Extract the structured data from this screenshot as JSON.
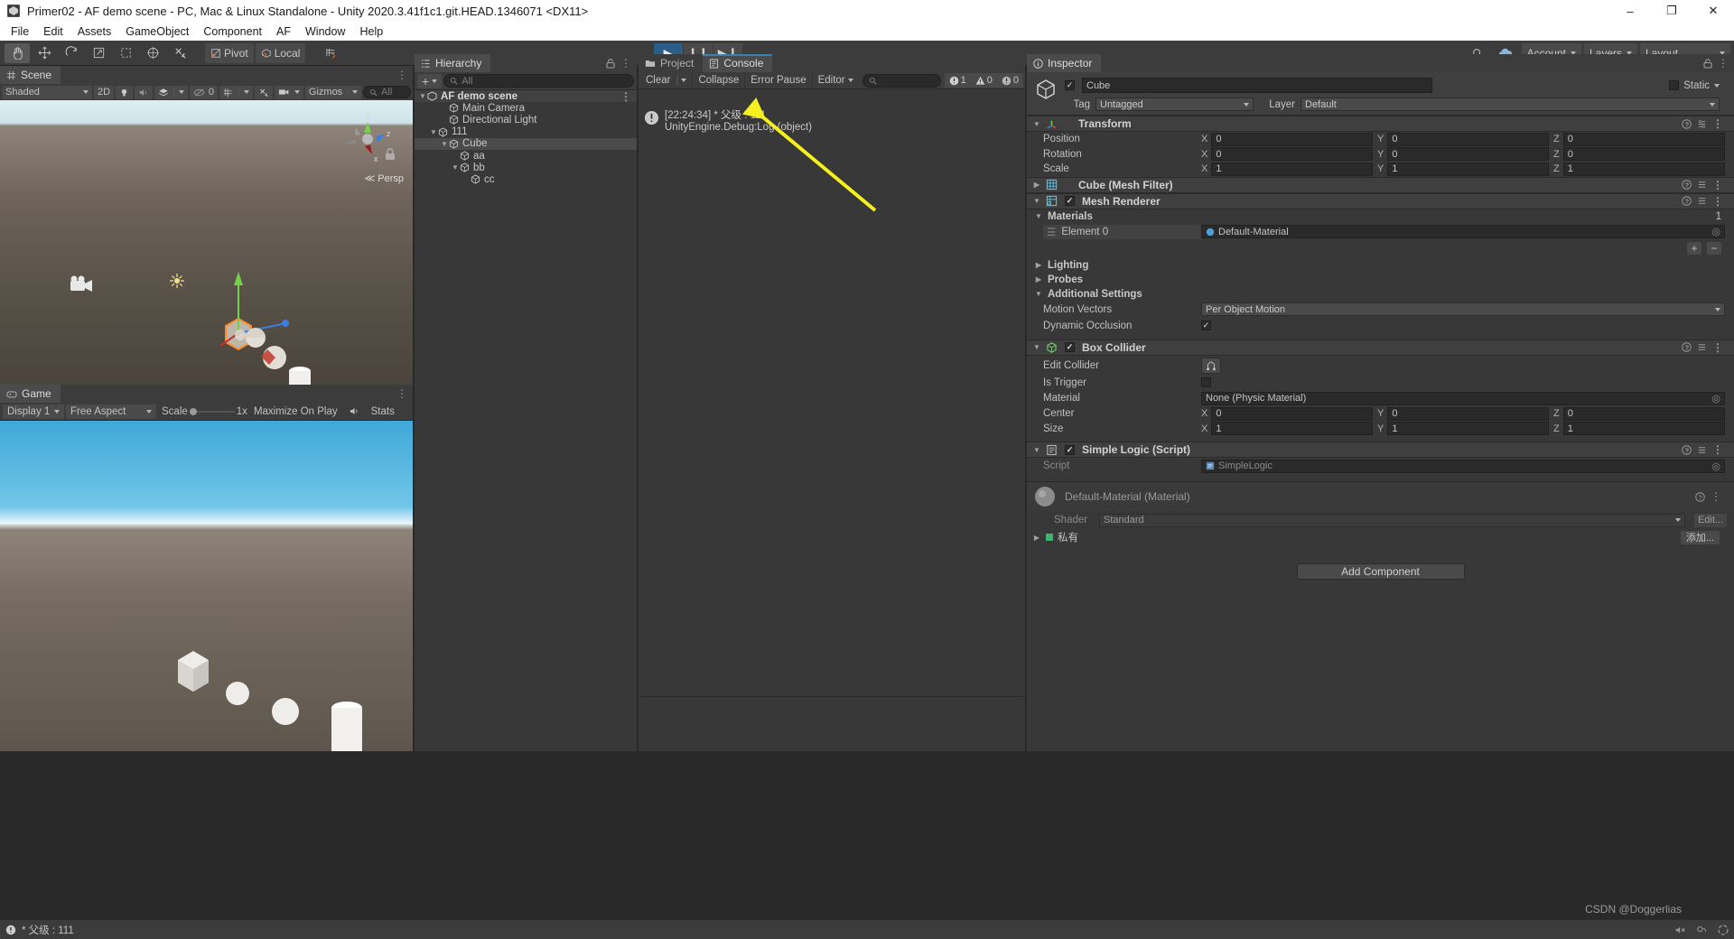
{
  "window": {
    "title": "Primer02 - AF demo scene - PC, Mac & Linux Standalone - Unity 2020.3.41f1c1.git.HEAD.1346071 <DX11>",
    "minimize": "–",
    "maximize": "❐",
    "close": "✕"
  },
  "menubar": {
    "items": [
      "File",
      "Edit",
      "Assets",
      "GameObject",
      "Component",
      "AF",
      "Window",
      "Help"
    ]
  },
  "toolbar": {
    "tools": [
      {
        "name": "hand-tool",
        "glyph": "✋"
      },
      {
        "name": "move-tool",
        "glyph": "✥"
      },
      {
        "name": "rotate-tool",
        "glyph": "↻"
      },
      {
        "name": "scale-tool",
        "glyph": "↗"
      },
      {
        "name": "rect-tool",
        "glyph": "⬚"
      },
      {
        "name": "transform-tool",
        "glyph": "⬤"
      },
      {
        "name": "custom-tool",
        "glyph": "⚒"
      }
    ],
    "pivot_label": "Pivot",
    "local_label": "Local",
    "snap_label": "",
    "play": "▶",
    "pause": "❙❙",
    "step": "▶❙",
    "cloud_label": "",
    "account_label": "Account",
    "layers_label": "Layers",
    "layout_label": "Layout"
  },
  "scene": {
    "tab_label": "Scene",
    "draw_mode": "Shaded",
    "mode_2d": "2D",
    "audio_count": "0",
    "gizmos_label": "Gizmos",
    "search_placeholder": "All",
    "persp_label": "Persp",
    "axis": {
      "x": "x",
      "y": "y",
      "z": "z"
    }
  },
  "game": {
    "tab_label": "Game",
    "display": "Display 1",
    "aspect": "Free Aspect",
    "scale_label": "Scale",
    "scale_value": "1x",
    "maximize_label": "Maximize On Play",
    "stats_label": "Stats"
  },
  "hierarchy": {
    "tab_label": "Hierarchy",
    "add_label": "+",
    "search_placeholder": "All",
    "items": [
      {
        "label": "AF demo scene",
        "depth": 0,
        "icon": "scene-icon",
        "expanded": true,
        "selected": false,
        "is_scene": true
      },
      {
        "label": "Main Camera",
        "depth": 2,
        "icon": "gameobject-icon",
        "expanded": null,
        "selected": false,
        "is_scene": false
      },
      {
        "label": "Directional Light",
        "depth": 2,
        "icon": "gameobject-icon",
        "expanded": null,
        "selected": false,
        "is_scene": false
      },
      {
        "label": "111",
        "depth": 1,
        "icon": "gameobject-icon",
        "expanded": true,
        "selected": false,
        "is_scene": false
      },
      {
        "label": "Cube",
        "depth": 2,
        "icon": "gameobject-icon",
        "expanded": true,
        "selected": true,
        "is_scene": false
      },
      {
        "label": "aa",
        "depth": 3,
        "icon": "gameobject-icon",
        "expanded": null,
        "selected": false,
        "is_scene": false
      },
      {
        "label": "bb",
        "depth": 3,
        "icon": "gameobject-icon",
        "expanded": true,
        "selected": false,
        "is_scene": false
      },
      {
        "label": "cc",
        "depth": 4,
        "icon": "gameobject-icon",
        "expanded": null,
        "selected": false,
        "is_scene": false
      }
    ]
  },
  "console": {
    "project_tab": "Project",
    "console_tab": "Console",
    "clear_label": "Clear",
    "collapse_label": "Collapse",
    "error_pause_label": "Error Pause",
    "editor_label": "Editor",
    "search_placeholder": "",
    "counts": {
      "error": "1",
      "warning": "0",
      "info": "0"
    },
    "messages": [
      {
        "line1": "[22:24:34] * 父级 : 111",
        "line2": "UnityEngine.Debug:Log (object)",
        "severity": "error"
      }
    ]
  },
  "inspector": {
    "tab_label": "Inspector",
    "object_name": "Cube",
    "object_enabled": true,
    "static_label": "Static",
    "tag_label": "Tag",
    "tag_value": "Untagged",
    "layer_label": "Layer",
    "layer_value": "Default",
    "transform": {
      "title": "Transform",
      "rows": [
        {
          "label": "Position",
          "x": "0",
          "y": "0",
          "z": "0"
        },
        {
          "label": "Rotation",
          "x": "0",
          "y": "0",
          "z": "0"
        },
        {
          "label": "Scale",
          "x": "1",
          "y": "1",
          "z": "1"
        }
      ],
      "axes": [
        "X",
        "Y",
        "Z"
      ]
    },
    "mesh_filter": {
      "title": "Cube (Mesh Filter)"
    },
    "mesh_renderer": {
      "title": "Mesh Renderer",
      "enabled": true,
      "materials_label": "Materials",
      "materials_size": "1",
      "element_label": "Element 0",
      "element_value": "Default-Material",
      "lighting_label": "Lighting",
      "probes_label": "Probes",
      "additional_label": "Additional Settings",
      "motion_vectors_label": "Motion Vectors",
      "motion_vectors_value": "Per Object Motion",
      "dynamic_occlusion_label": "Dynamic Occlusion",
      "dynamic_occlusion_checked": true,
      "plus": "+",
      "minus": "−"
    },
    "box_collider": {
      "title": "Box Collider",
      "enabled": true,
      "edit_collider_label": "Edit Collider",
      "is_trigger_label": "Is Trigger",
      "is_trigger_checked": false,
      "material_label": "Material",
      "material_value": "None (Physic Material)",
      "center_label": "Center",
      "center": {
        "x": "0",
        "y": "0",
        "z": "0"
      },
      "size_label": "Size",
      "size": {
        "x": "1",
        "y": "1",
        "z": "1"
      }
    },
    "simple_logic": {
      "title": "Simple Logic (Script)",
      "enabled": true,
      "script_label": "Script",
      "script_value": "SimpleLogic"
    },
    "material_preview": {
      "title": "Default-Material (Material)",
      "shader_label": "Shader",
      "shader_value": "Standard",
      "edit_label": "Edit...",
      "private_label": "私有",
      "add_label": "添加..."
    },
    "add_component_label": "Add Component"
  },
  "statusbar": {
    "message": "* 父级 : 111"
  },
  "watermark": "CSDN @Doggerlias",
  "colors": {
    "accent_blue": "#3c7fb1",
    "panel_bg": "#383838",
    "header_bg": "#3c3c3c",
    "selection": "#4b4b4b",
    "arrow_yellow": "#f5f01e",
    "play_blue": "#2c5d87"
  }
}
